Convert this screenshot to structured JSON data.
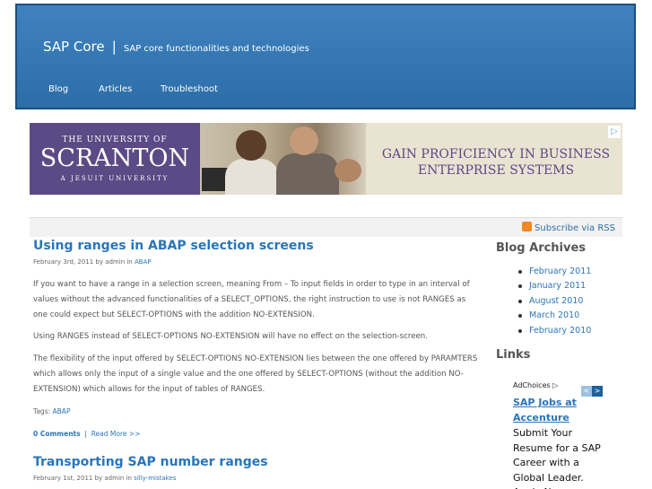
{
  "header": {
    "site_title": "SAP Core",
    "separator": "|",
    "site_desc": "SAP core functionalities and technologies",
    "nav": [
      "Blog",
      "Articles",
      "Troubleshoot"
    ],
    "colors": {
      "header_bg": "#3a7ab5",
      "link": "#2a75b8"
    }
  },
  "banner": {
    "univ_line": "THE UNIVERSITY OF",
    "univ_name": "SCRANTON",
    "univ_sub": "A JESUIT UNIVERSITY",
    "slogan_line1": "GAIN PROFICIENCY IN BUSINESS",
    "slogan_line2": "ENTERPRISE SYSTEMS",
    "adchoice_icon": "adchoices-triangle-icon"
  },
  "rss": {
    "label": "Subscribe via RSS",
    "icon": "rss-icon"
  },
  "posts": [
    {
      "title": "Using ranges in ABAP selection screens",
      "meta_prefix": "February 3rd, 2011 by admin in",
      "meta_cat": "ABAP",
      "paragraphs": [
        "If you want to have a range in a selection screen, meaning From – To input fields in order to type in an interval of values without the advanced functionalities of a SELECT_OPTIONS, the right instruction to use is not RANGES as one could expect but SELECT-OPTIONS with the addition NO-EXTENSION.",
        "Using RANGES instead of SELECT-OPTIONS NO-EXTENSION will have no effect on the selection-screen.",
        "The flexibility of the input offered by SELECT-OPTIONS NO-EXTENSION lies between the one offered by PARAMTERS which allows only the input of a single value and the one offered by SELECT-OPTIONS (without the addition NO-EXTENSION) which allows for the input of tables of RANGES."
      ],
      "tags_label": "Tags:",
      "tag": "ABAP",
      "comments": "0 Comments",
      "sep": "|",
      "read_more": "Read More >>"
    },
    {
      "title": "Transporting SAP number ranges",
      "meta_prefix": "February 1st, 2011 by admin in",
      "meta_cat": "silly-mistakes"
    }
  ],
  "sidebar": {
    "archives_title": "Blog Archives",
    "archives": [
      "February 2011",
      "January 2011",
      "August 2010",
      "March 2010",
      "February 2010"
    ],
    "links_title": "Links",
    "ad": {
      "adchoices": "AdChoices",
      "prev_icon": "chevron-left-icon",
      "next_icon": "chevron-right-icon",
      "link": "SAP Jobs at Accenture",
      "text": "Submit Your Resume for a SAP Career with a Global Leader. Apply Now"
    }
  }
}
